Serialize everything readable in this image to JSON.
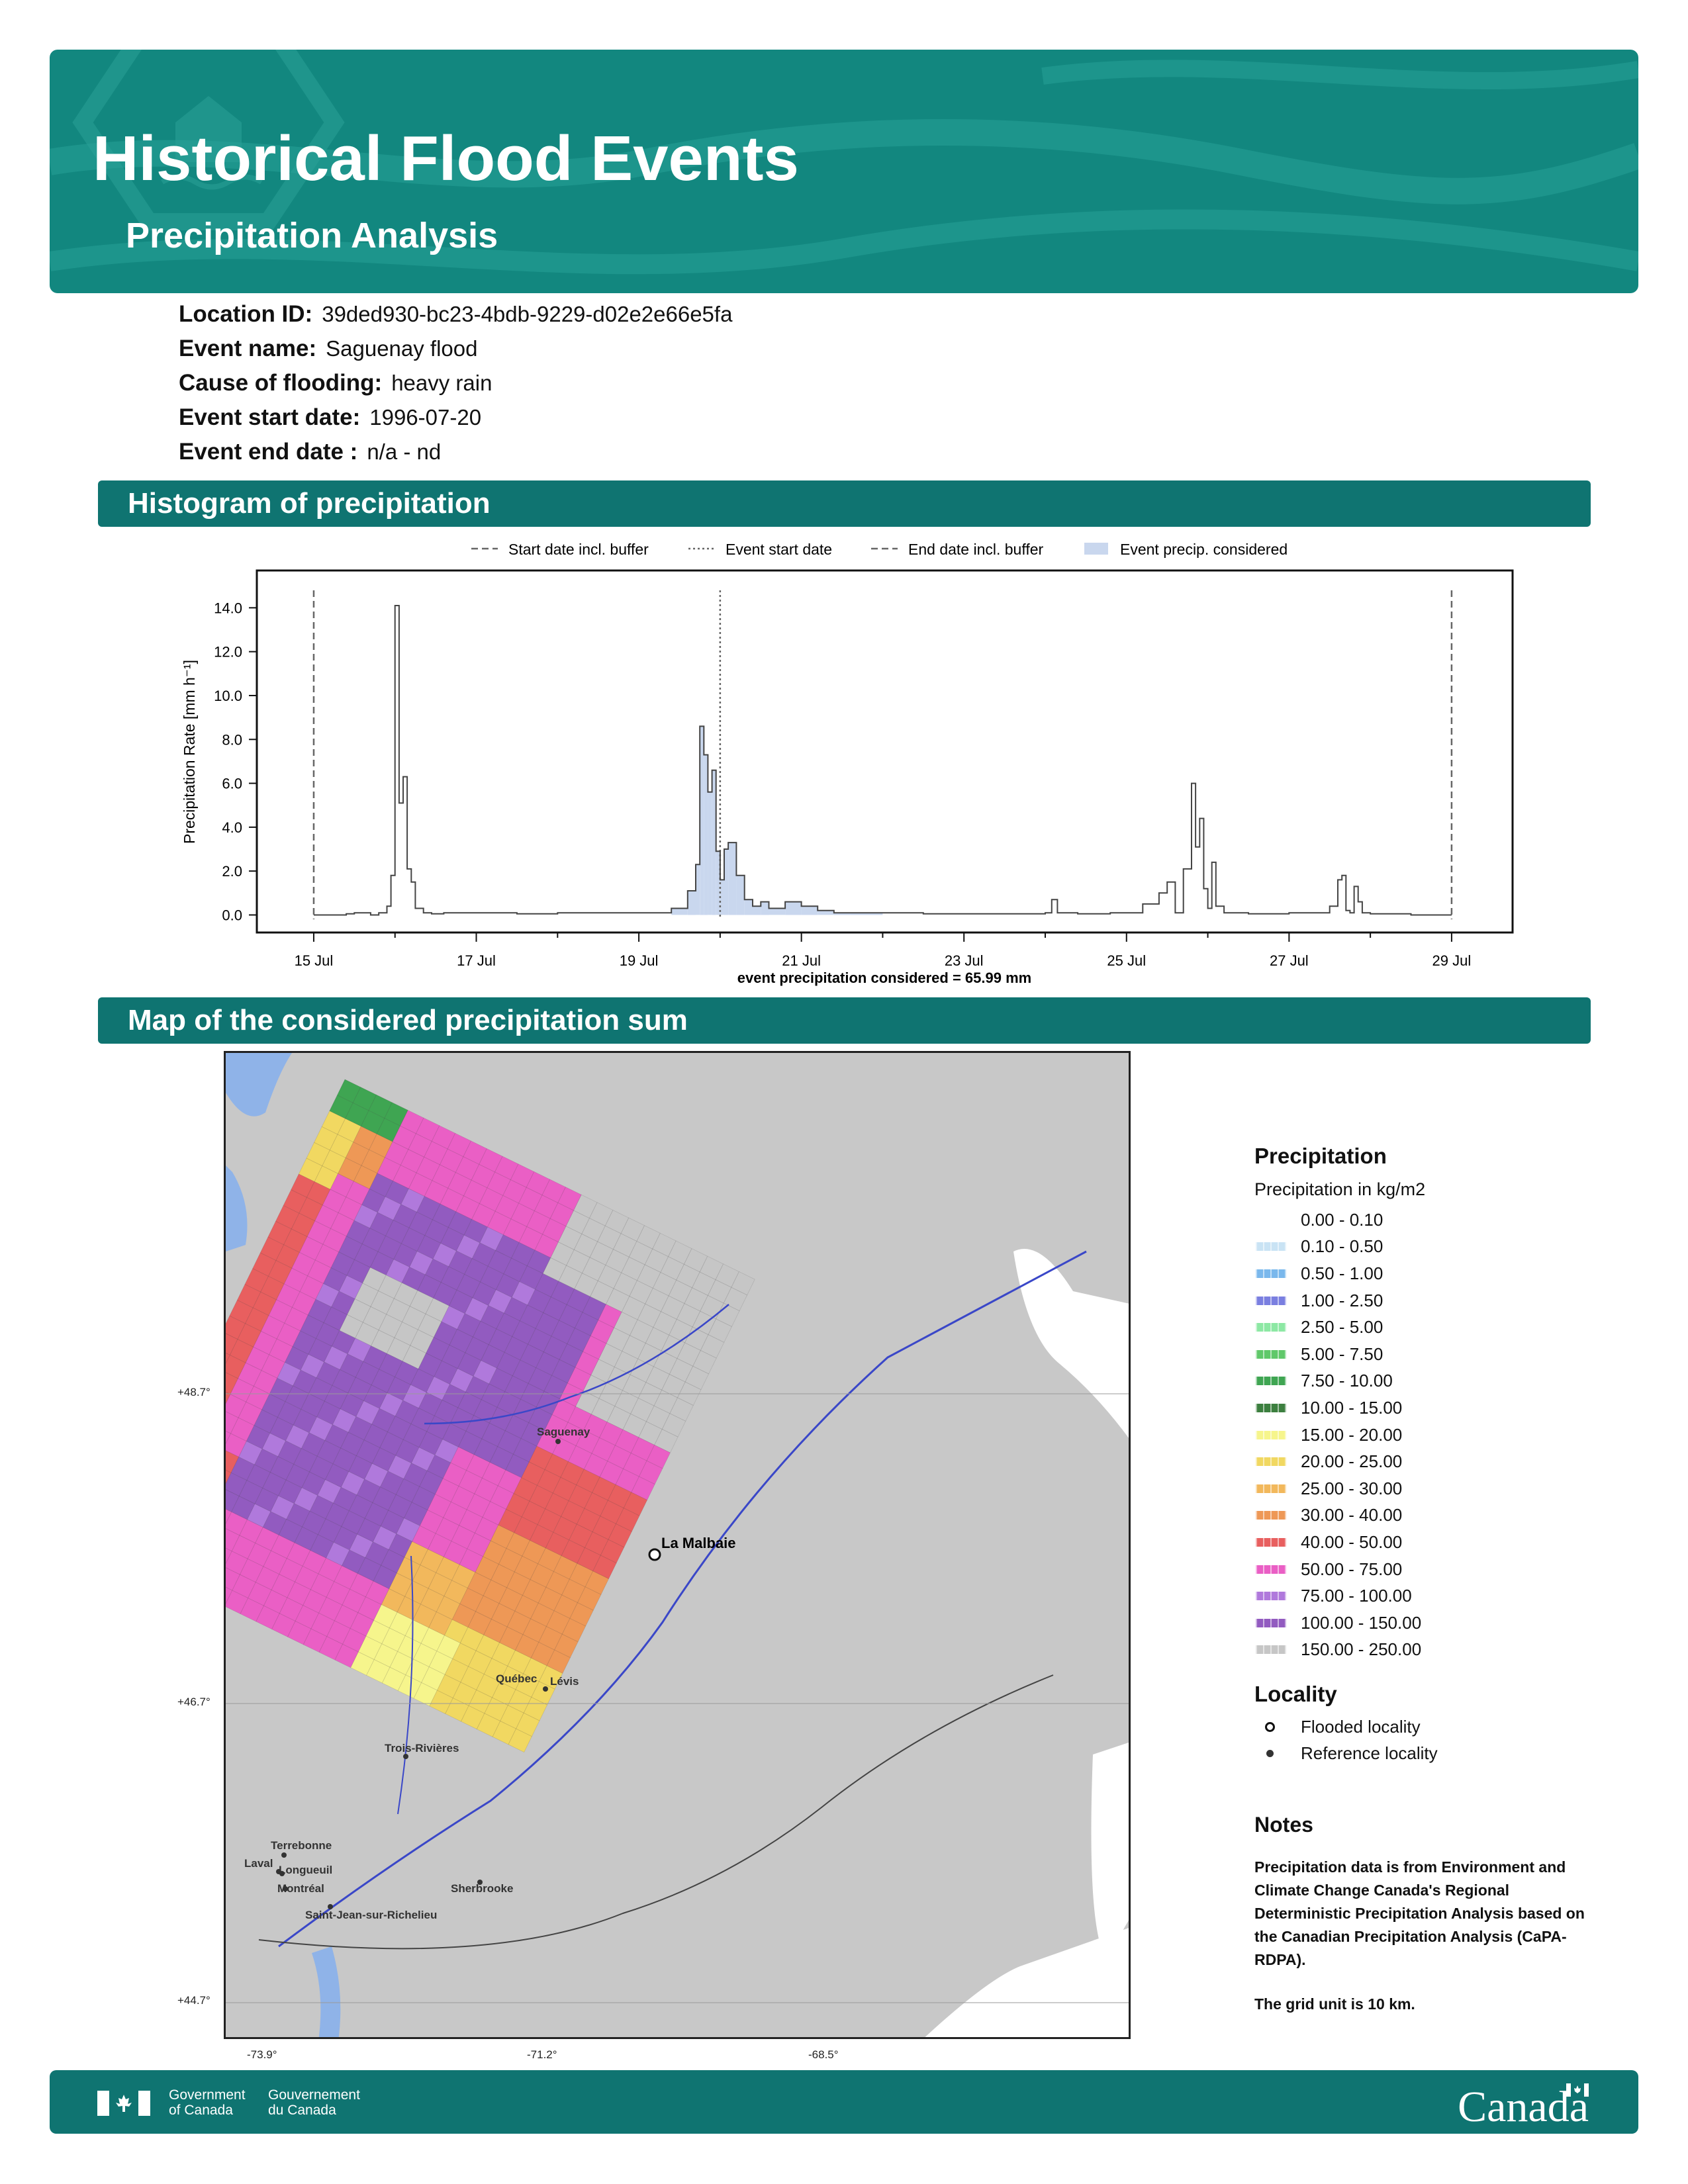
{
  "header": {
    "title": "Historical Flood Events",
    "subtitle": "Precipitation Analysis"
  },
  "event": {
    "location_id_label": "Location ID:",
    "location_id": "39ded930-bc23-4bdb-9229-d02e2e66e5fa",
    "name_label": "Event name:",
    "name": "Saguenay flood",
    "cause_label": "Cause of flooding:",
    "cause": "heavy rain",
    "start_label": "Event start date:",
    "start": "1996-07-20",
    "end_label": "Event end date :",
    "end": "n/a - nd"
  },
  "sections": {
    "histogram": "Histogram of precipitation",
    "map": "Map of the considered precipitation sum"
  },
  "chart_data": {
    "type": "line",
    "ylabel": "Precipitation Rate [mm h⁻¹]",
    "xlabel": "event precipitation considered = 65.99 mm",
    "y_ticks": [
      "0.0",
      "2.0",
      "4.0",
      "6.0",
      "8.0",
      "10.0",
      "12.0",
      "14.0"
    ],
    "ylim": [
      -0.8,
      15.7
    ],
    "x_ticks": [
      "15 Jul",
      "17 Jul",
      "19 Jul",
      "21 Jul",
      "23 Jul",
      "25 Jul",
      "27 Jul",
      "29 Jul"
    ],
    "x_tick_days": [
      15,
      17,
      19,
      21,
      23,
      25,
      27,
      29
    ],
    "xlim": [
      14.3,
      29.75
    ],
    "legend": [
      "Start date incl. buffer",
      "Event start date",
      "End date incl. buffer",
      "Event precip. considered"
    ],
    "legend_position": "top",
    "start_buffer_day": 15.0,
    "event_start_day": 20.0,
    "end_buffer_day": 29.0,
    "series": [
      {
        "days": [
          15.0,
          15.4,
          15.5,
          15.7,
          15.8,
          15.9,
          15.95,
          16.0,
          16.05,
          16.1,
          16.15,
          16.2,
          16.25,
          16.35,
          16.45,
          16.6,
          17.0,
          17.5,
          18.0,
          18.5,
          19.0,
          19.4,
          19.6,
          19.7,
          19.75,
          19.8,
          19.85,
          19.9,
          19.95,
          20.0,
          20.05,
          20.1,
          20.2,
          20.3,
          20.4,
          20.5,
          20.6,
          20.8,
          21.0,
          21.2,
          21.4,
          21.6,
          22.0,
          22.5,
          23.0,
          23.5,
          24.0,
          24.08,
          24.15,
          24.4,
          24.8,
          25.2,
          25.4,
          25.5,
          25.6,
          25.7,
          25.8,
          25.85,
          25.9,
          25.95,
          26.0,
          26.05,
          26.1,
          26.2,
          26.5,
          27.0,
          27.5,
          27.6,
          27.65,
          27.7,
          27.75,
          27.8,
          27.85,
          27.9,
          28.0,
          28.5,
          29.0
        ],
        "values": [
          0.0,
          0.05,
          0.1,
          0.0,
          0.1,
          0.4,
          1.8,
          14.1,
          5.1,
          6.3,
          2.1,
          1.5,
          0.3,
          0.1,
          0.05,
          0.1,
          0.1,
          0.05,
          0.1,
          0.1,
          0.1,
          0.3,
          1.1,
          2.3,
          8.6,
          7.3,
          5.6,
          6.6,
          2.9,
          1.6,
          3.0,
          3.3,
          1.8,
          0.7,
          0.4,
          0.6,
          0.3,
          0.6,
          0.4,
          0.2,
          0.1,
          0.1,
          0.1,
          0.05,
          0.05,
          0.05,
          0.1,
          0.7,
          0.1,
          0.05,
          0.1,
          0.5,
          1.0,
          1.5,
          0.1,
          2.1,
          6.0,
          3.1,
          4.4,
          1.2,
          0.3,
          2.4,
          0.4,
          0.1,
          0.05,
          0.1,
          0.4,
          1.6,
          1.8,
          0.2,
          0.1,
          1.3,
          0.6,
          0.1,
          0.05,
          0.0,
          0.0
        ]
      }
    ]
  },
  "map_legend": {
    "title": "Precipitation",
    "subtitle": "Precipitation in kg/m2",
    "items": [
      {
        "label": "0.00 - 0.10",
        "color": "#ffffff"
      },
      {
        "label": "0.10 - 0.50",
        "color": "#c9e3f4"
      },
      {
        "label": "0.50 - 1.00",
        "color": "#7ab8ec"
      },
      {
        "label": "1.00 - 2.50",
        "color": "#7a7fe0"
      },
      {
        "label": "2.50 - 5.00",
        "color": "#8de8a4"
      },
      {
        "label": "5.00 - 7.50",
        "color": "#60c86a"
      },
      {
        "label": "7.50 - 10.00",
        "color": "#3fa552"
      },
      {
        "label": "10.00 - 15.00",
        "color": "#3c7f3f"
      },
      {
        "label": "15.00 - 20.00",
        "color": "#f6f58c"
      },
      {
        "label": "20.00 - 25.00",
        "color": "#f1d861"
      },
      {
        "label": "25.00 - 30.00",
        "color": "#f2b85c"
      },
      {
        "label": "30.00 - 40.00",
        "color": "#ee9856"
      },
      {
        "label": "40.00 - 50.00",
        "color": "#e85f5f"
      },
      {
        "label": "50.00 - 75.00",
        "color": "#ea5fc5"
      },
      {
        "label": "75.00 - 100.00",
        "color": "#b079dc"
      },
      {
        "label": "100.00 - 150.00",
        "color": "#925bc0"
      },
      {
        "label": "150.00 - 250.00",
        "color": "#c6c6c6"
      }
    ],
    "locality_title": "Locality",
    "flooded": "Flooded locality",
    "reference": "Reference locality"
  },
  "map_labels": {
    "la_malbaie": "La Malbaie",
    "saguenay": "Saguenay",
    "quebec": "Québec",
    "levis": "Lévis",
    "trois_rivieres": "Trois-Rivières",
    "terrebonne": "Terrebonne",
    "laval": "Laval",
    "longueuil": "Longueuil",
    "montreal": "Montréal",
    "sherbrooke": "Sherbrooke",
    "saint_jean": "Saint-Jean-sur-Richelieu",
    "lat_1": "+48.7°",
    "lat_2": "+46.7°",
    "lat_3": "+44.7°",
    "lon_1": "-73.9°",
    "lon_2": "-71.2°",
    "lon_3": "-68.5°"
  },
  "notes": {
    "title": "Notes",
    "text": "Precipitation data is from Environment and Climate Change Canada's Regional Deterministic Precipitation Analysis based on the Canadian Precipitation Analysis (CaPA-RDPA).",
    "grid": "The grid unit is 10 km."
  },
  "footer": {
    "gov_en_1": "Government",
    "gov_en_2": "of Canada",
    "gov_fr_1": "Gouvernement",
    "gov_fr_2": "du Canada",
    "wordmark": "Canada"
  }
}
